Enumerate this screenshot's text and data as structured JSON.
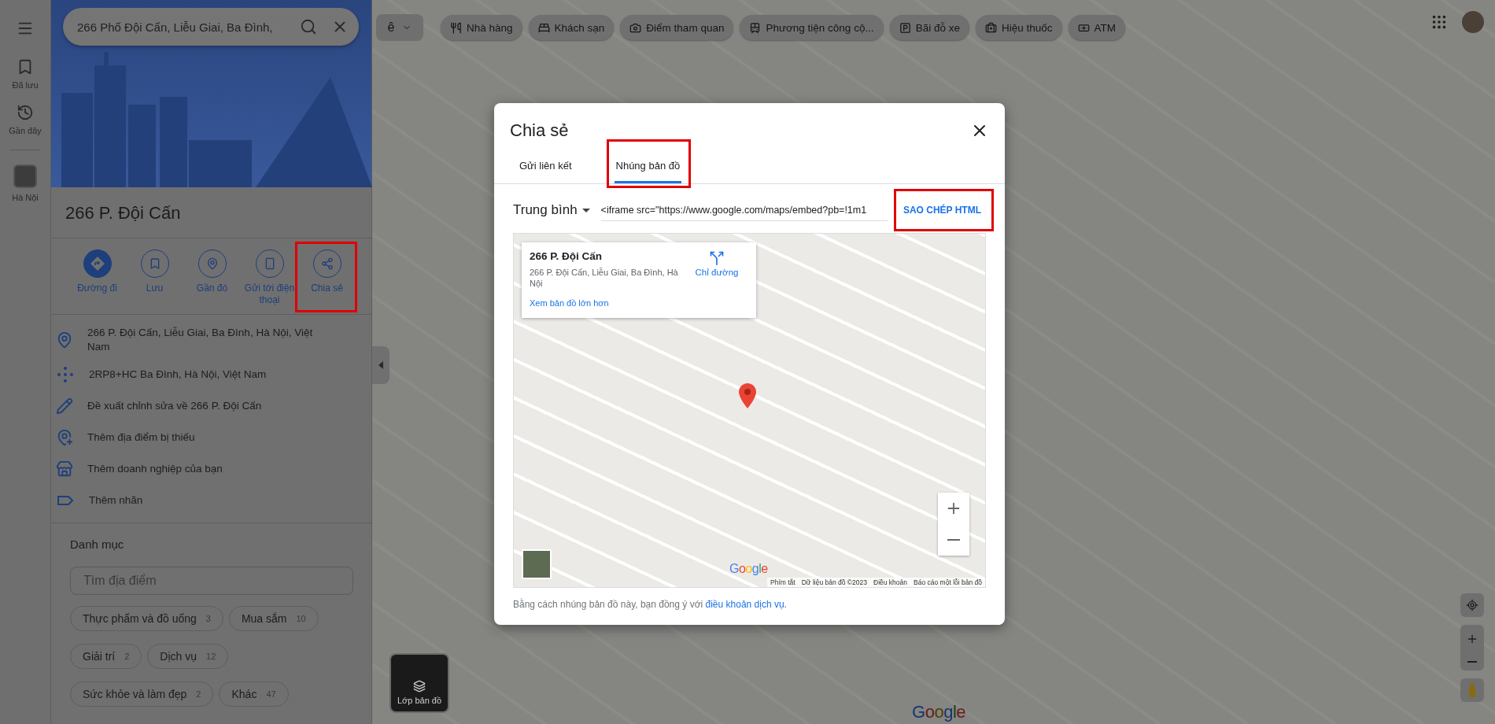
{
  "rail": {
    "items": [
      {
        "kind": "saved",
        "label": "Đã lưu"
      },
      {
        "kind": "recent",
        "label": "Gần đây"
      },
      {
        "kind": "place",
        "label": "Hà Nội"
      }
    ]
  },
  "search": {
    "value": "266 Phố Đội Cấn, Liễu Giai, Ba Đình,"
  },
  "place": {
    "title": "266 P. Đội Cấn",
    "actions": [
      {
        "kind": "directions",
        "label": "Đường đi",
        "highlighted": false
      },
      {
        "kind": "save",
        "label": "Lưu",
        "highlighted": false
      },
      {
        "kind": "nearby",
        "label": "Gần đó",
        "highlighted": false
      },
      {
        "kind": "send",
        "label": "Gửi tới điện thoại",
        "highlighted": false
      },
      {
        "kind": "share",
        "label": "Chia sẻ",
        "highlighted": true
      }
    ],
    "details": [
      {
        "kind": "address",
        "text": "266 P. Đội Cấn, Liễu Giai, Ba Đình, Hà Nội, Việt Nam"
      },
      {
        "kind": "pluscode",
        "text": "2RP8+HC Ba Đình, Hà Nội, Việt Nam"
      },
      {
        "kind": "edit",
        "text": "Đề xuất chỉnh sửa về 266 P. Đội Cấn"
      },
      {
        "kind": "addplace",
        "text": "Thêm địa điểm bị thiếu"
      },
      {
        "kind": "business",
        "text": "Thêm doanh nghiệp của bạn"
      },
      {
        "kind": "label",
        "text": "Thêm nhãn"
      }
    ]
  },
  "categories": {
    "heading": "Danh mục",
    "placeholder": "Tìm địa điểm",
    "chips": [
      {
        "label": "Thực phẩm và đồ uống",
        "count": "3"
      },
      {
        "label": "Mua sắm",
        "count": "10"
      },
      {
        "label": "Giải trí",
        "count": "2"
      },
      {
        "label": "Dịch vụ",
        "count": "12"
      },
      {
        "label": "Sức khỏe và làm đẹp",
        "count": "2"
      },
      {
        "label": "Khác",
        "count": "47"
      }
    ]
  },
  "map": {
    "input_method": "ê",
    "chips": [
      {
        "kind": "restaurant",
        "label": "Nhà hàng"
      },
      {
        "kind": "hotel",
        "label": "Khách sạn"
      },
      {
        "kind": "attraction",
        "label": "Điểm tham quan"
      },
      {
        "kind": "transit",
        "label": "Phương tiện công cộ..."
      },
      {
        "kind": "parking",
        "label": "Bãi đỗ xe"
      },
      {
        "kind": "pharmacy",
        "label": "Hiệu thuốc"
      },
      {
        "kind": "atm",
        "label": "ATM"
      }
    ],
    "layer_button": "Lớp bản đồ",
    "logo": "Google"
  },
  "dialog": {
    "title": "Chia sẻ",
    "tabs": [
      {
        "label": "Gửi liên kết",
        "selected": false,
        "highlighted": false
      },
      {
        "label": "Nhúng bản đồ",
        "selected": true,
        "highlighted": true
      }
    ],
    "size_select": "Trung bình",
    "embed_code": "<iframe src=\"https://www.google.com/maps/embed?pb=!1m1",
    "copy_button": {
      "label": "SAO CHÉP HTML",
      "highlighted": true
    },
    "preview": {
      "card_title": "266 P. Đội Cấn",
      "card_address": "266 P. Đội Cấn, Liễu Giai, Ba Đình, Hà Nội",
      "directions": "Chỉ đường",
      "larger_map": "Xem bản đồ lớn hơn",
      "logo": "Google",
      "footer": [
        "Phím tắt",
        "Dữ liệu bản đồ ©2023",
        "Điều khoản",
        "Báo cáo một lỗi bản đồ"
      ]
    },
    "terms": {
      "text": "Bằng cách nhúng bản đồ này, bạn đồng ý với",
      "link": "điều khoản dịch vụ."
    }
  }
}
